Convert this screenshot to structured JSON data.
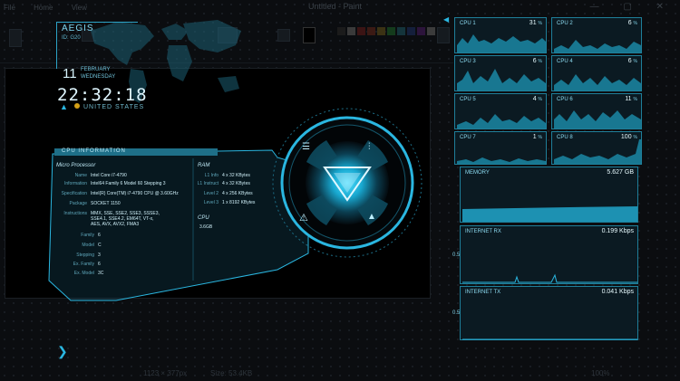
{
  "paint_window": {
    "title": "Untitled - Paint",
    "tabs": [
      "File",
      "Home",
      "View"
    ],
    "status_size": "1123 × 377px",
    "status_disk": "Size: 53.4KB",
    "zoom": "100%"
  },
  "aegis": {
    "logo": "AEGIS",
    "id": "ID: G20",
    "day": "11",
    "month": "FEBRUARY",
    "weekday": "WEDNESDAY",
    "time": "22:32:18",
    "country": "UNITED STATES",
    "accent": "#2ab6e0"
  },
  "cpu_info": {
    "title": "CPU INFORMATION",
    "micro_heading": "Micro Processor",
    "fields": [
      {
        "k": "Name",
        "v": "Intel Core i7-4790"
      },
      {
        "k": "Information",
        "v": "Intel64 Family 6 Model 60 Stepping 3"
      },
      {
        "k": "Specification",
        "v": "Intel(R) Core(TM) i7-4790 CPU @ 3.60GHz"
      },
      {
        "k": "Package",
        "v": "SOCKET 1150"
      },
      {
        "k": "Instructions",
        "v": "MMX, SSE, SSE2, SSE3, SSSE3, SSE4.1, SSE4.2, EM64T, VT-x, AES, AVX, AVX2, FMA3"
      },
      {
        "k": "Family",
        "v": "6"
      },
      {
        "k": "Model",
        "v": "C"
      },
      {
        "k": "Stepping",
        "v": "3"
      },
      {
        "k": "Ex. Family",
        "v": "6"
      },
      {
        "k": "Ex. Model",
        "v": "3C"
      }
    ],
    "ram_heading": "RAM",
    "cache": [
      {
        "k": "L1 Info",
        "v": "4 x 32 KBytes"
      },
      {
        "k": "L1 Instruct",
        "v": "4 x 32 KBytes"
      },
      {
        "k": "Level 2",
        "v": "4 x 256 KBytes"
      },
      {
        "k": "Level 3",
        "v": "1 x 8192 KBytes"
      }
    ],
    "cpu_heading": "CPU",
    "cpu_speed": "3.6GB"
  },
  "monitors": {
    "cpus": [
      {
        "label": "CPU 1",
        "value": "31",
        "unit": "%"
      },
      {
        "label": "CPU 2",
        "value": "6",
        "unit": "%"
      },
      {
        "label": "CPU 3",
        "value": "6",
        "unit": "%"
      },
      {
        "label": "CPU 4",
        "value": "6",
        "unit": "%"
      },
      {
        "label": "CPU 5",
        "value": "4",
        "unit": "%"
      },
      {
        "label": "CPU 6",
        "value": "11",
        "unit": "%"
      },
      {
        "label": "CPU 7",
        "value": "1",
        "unit": "%"
      },
      {
        "label": "CPU 8",
        "value": "100",
        "unit": "%"
      }
    ],
    "memory": {
      "label": "MEMORY",
      "value": "5.627 GB"
    },
    "rx": {
      "label": "INTERNET RX",
      "value": "0.199 Kbps",
      "ytick": "0.5"
    },
    "tx": {
      "label": "INTERNET TX",
      "value": "0.041 Kbps",
      "ytick": "0.5"
    },
    "accent": "#26b5da"
  }
}
